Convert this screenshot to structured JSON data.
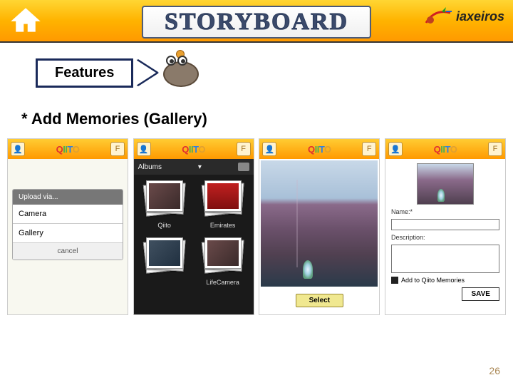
{
  "header": {
    "title": "STORYBOARD",
    "brand": "iaxeiros",
    "home_icon": "home-icon"
  },
  "features": {
    "label": "Features"
  },
  "subtitle": "* Add Memories (Gallery)",
  "app": {
    "name_parts": {
      "q": "Q",
      "ii": "II",
      "t": "T",
      "o": "O"
    },
    "header_left_icon": "person",
    "header_right_icon": "F"
  },
  "screens": {
    "upload": {
      "title": "Upload via...",
      "options": [
        "Camera",
        "Gallery"
      ],
      "cancel": "cancel"
    },
    "albums": {
      "bar_label": "Albums",
      "items": [
        "Qiito",
        "Emirates",
        "",
        "LifeCamera"
      ]
    },
    "preview": {
      "select": "Select"
    },
    "form": {
      "name_label": "Name:*",
      "desc_label": "Description:",
      "checkbox_label": "Add to Qiito Memories",
      "save": "SAVE"
    }
  },
  "page_number": "26"
}
